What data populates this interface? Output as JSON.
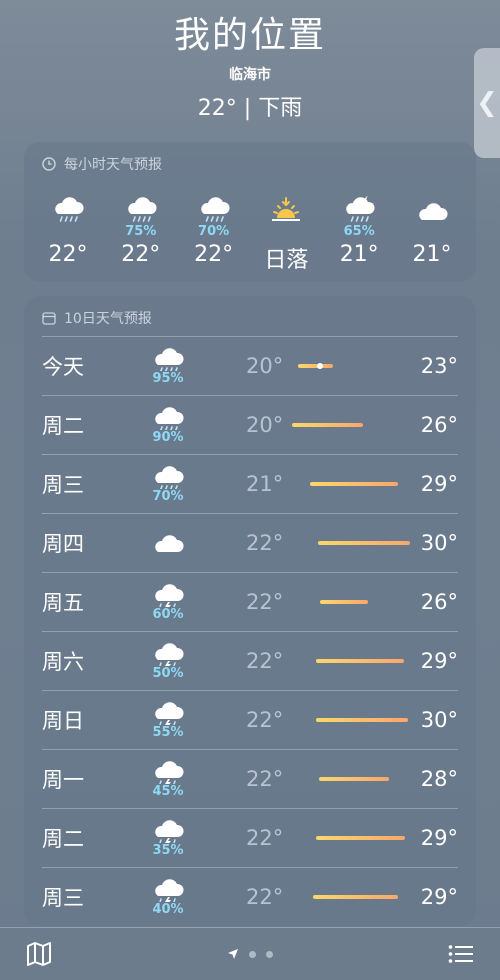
{
  "header": {
    "title": "我的位置",
    "city": "临海市",
    "current": "22° | 下雨"
  },
  "side_tab_icon": "chevron-left-icon",
  "hourly": {
    "title": "每小时天气预报",
    "items": [
      {
        "icon": "cloud-rain-icon",
        "pop": "",
        "temp": "22°"
      },
      {
        "icon": "cloud-rain-icon",
        "pop": "75%",
        "temp": "22°"
      },
      {
        "icon": "cloud-rain-icon",
        "pop": "70%",
        "temp": "22°"
      },
      {
        "icon": "sunset-icon",
        "pop": "",
        "temp": "日落"
      },
      {
        "icon": "cloud-moon-rain-icon",
        "pop": "65%",
        "temp": "21°"
      },
      {
        "icon": "cloud-icon",
        "pop": "",
        "temp": "21°"
      }
    ]
  },
  "daily": {
    "title": "10日天气预报",
    "rows": [
      {
        "day": "今天",
        "icon": "cloud-rain-icon",
        "pop": "95%",
        "low": "20°",
        "high": "23°",
        "bar_start": 0.05,
        "bar_end": 0.35,
        "current": true
      },
      {
        "day": "周二",
        "icon": "cloud-rain-icon",
        "pop": "90%",
        "low": "20°",
        "high": "26°",
        "bar_start": 0.0,
        "bar_end": 0.6
      },
      {
        "day": "周三",
        "icon": "cloud-rain-icon",
        "pop": "70%",
        "low": "21°",
        "high": "29°",
        "bar_start": 0.15,
        "bar_end": 0.9
      },
      {
        "day": "周四",
        "icon": "cloud-icon",
        "pop": "",
        "low": "22°",
        "high": "30°",
        "bar_start": 0.22,
        "bar_end": 1.0
      },
      {
        "day": "周五",
        "icon": "cloud-bolt-rain-icon",
        "pop": "60%",
        "low": "22°",
        "high": "26°",
        "bar_start": 0.24,
        "bar_end": 0.64
      },
      {
        "day": "周六",
        "icon": "cloud-bolt-rain-icon",
        "pop": "50%",
        "low": "22°",
        "high": "29°",
        "bar_start": 0.2,
        "bar_end": 0.95
      },
      {
        "day": "周日",
        "icon": "cloud-bolt-rain-icon",
        "pop": "55%",
        "low": "22°",
        "high": "30°",
        "bar_start": 0.2,
        "bar_end": 0.98
      },
      {
        "day": "周一",
        "icon": "cloud-bolt-rain-icon",
        "pop": "45%",
        "low": "22°",
        "high": "28°",
        "bar_start": 0.23,
        "bar_end": 0.82
      },
      {
        "day": "周二",
        "icon": "cloud-bolt-rain-icon",
        "pop": "35%",
        "low": "22°",
        "high": "29°",
        "bar_start": 0.2,
        "bar_end": 0.96
      },
      {
        "day": "周三",
        "icon": "cloud-bolt-rain-icon",
        "pop": "40%",
        "low": "22°",
        "high": "29°",
        "bar_start": 0.18,
        "bar_end": 0.9
      }
    ]
  },
  "bottom": {
    "left_icon": "map-icon",
    "right_icon": "list-icon",
    "page_icons": [
      "location-arrow-icon",
      "page-dot",
      "page-dot"
    ]
  },
  "colors": {
    "pop": "#8fd8f3",
    "bar_start": "#f9d86c",
    "bar_end": "#f9a66c"
  }
}
